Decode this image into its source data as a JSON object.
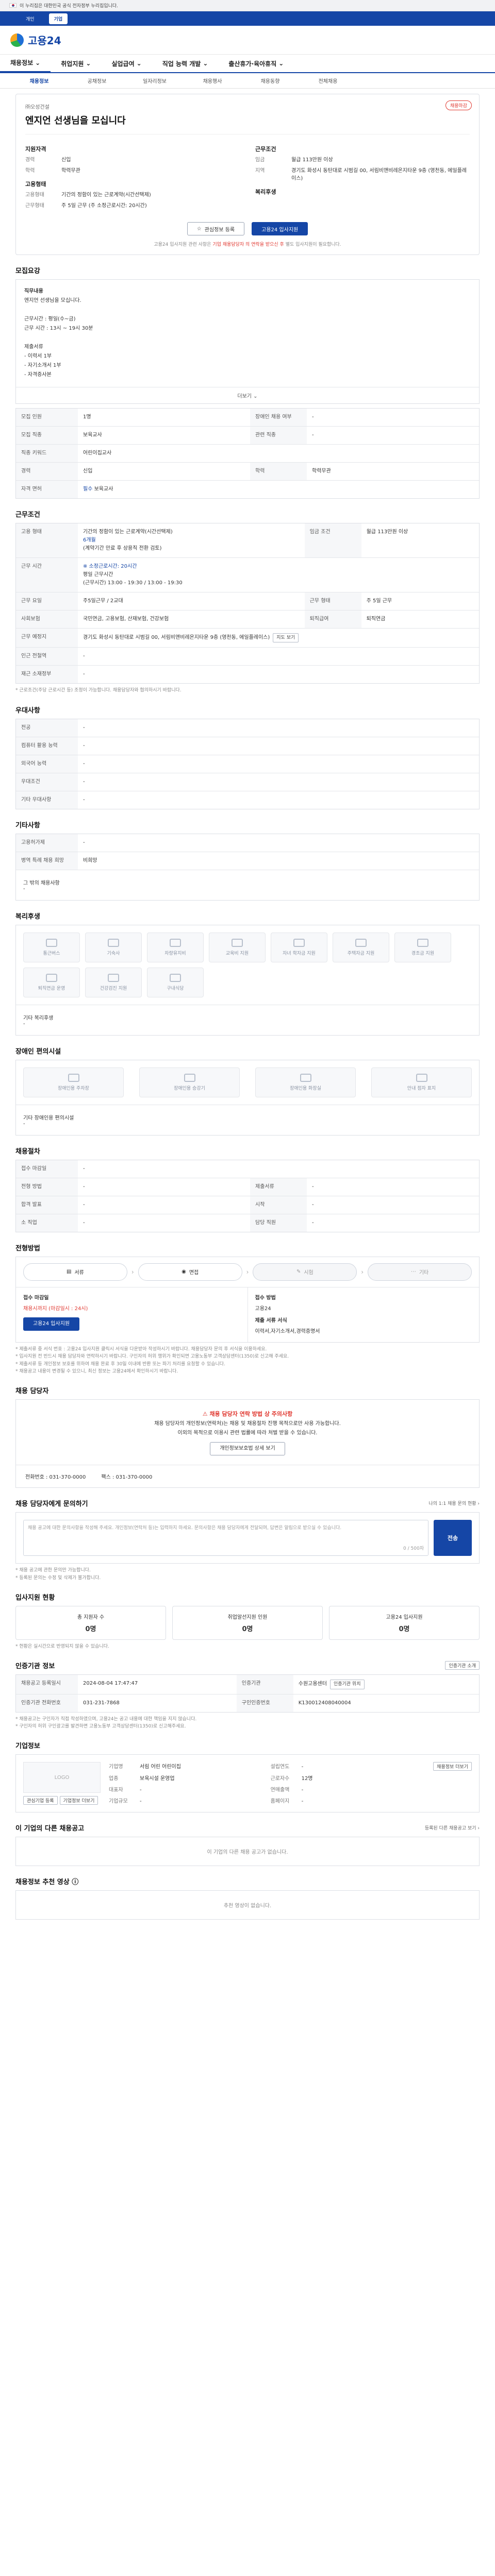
{
  "gov_banner": "이 누리집은 대한민국 공식 전자정부 누리집입니다.",
  "util_tabs": [
    "개인",
    "기업"
  ],
  "brand": {
    "name": "고용24",
    "accent": "#1546a6"
  },
  "gnb": [
    "채용정보",
    "취업지원",
    "실업급여",
    "직업 능력 개발",
    "출산휴가·육아휴직"
  ],
  "subnav": [
    "채용정보",
    "공채정보",
    "일자리정보",
    "채용행사",
    "채용동향",
    "전체채용"
  ],
  "summary": {
    "badge": "채용마감",
    "company": "㈜오성건설",
    "title": "엔지언 선생님을 모십니다",
    "left_head": "지원자격",
    "left": [
      {
        "k": "경력",
        "v": "신입"
      },
      {
        "k": "학력",
        "v": "학력무관"
      }
    ],
    "left_head2": "고용형태",
    "left2": [
      {
        "k": "고용형태",
        "v": "기간의 정함이 있는 근로계약(시간선택제)"
      },
      {
        "k": "근무형태",
        "v": "주 5일 근무 (주 소정근로시간: 20시간)"
      }
    ],
    "right_head": "근무조건",
    "right": [
      {
        "k": "임금",
        "v": "월급 113만원 이상"
      },
      {
        "k": "지역",
        "v": "경기도 화성시 동탄대로 시범길 00, 서림비앤비레온지타운 9층 (영천동, 에일플레이스)"
      }
    ],
    "right_head2": "복리후생",
    "btn_scrap": "관심정보 등록",
    "btn_apply": "고용24 입사지원",
    "note_pre": "고용24 입사지원 관련 사항은 ",
    "note_red": "기업 채용담당자 의 연락을 받으신 후",
    "note_post": " 별도 입사지원이 필요합니다."
  },
  "recruit": {
    "heading": "모집요강",
    "desc_title": "직무내용",
    "desc_lines": [
      "엔지언 선생님을 모십니다.",
      "",
      "근무시간 : 평일(수~금)",
      "근무 시간 : 13시 ~ 19시 30분",
      "",
      "제출서류",
      "- 이력서 1부",
      "- 자기소개서 1부",
      "- 자격증사본"
    ],
    "more": "더보기 ⌄",
    "rows": [
      {
        "k": "모집 인원",
        "v": "1명",
        "k2": "장애인 채용 여부",
        "v2": "-"
      },
      {
        "k": "모집 직종",
        "v": "보육교사",
        "k2": "관련 직종",
        "v2": "-"
      },
      {
        "k": "직종 키워드",
        "v": "어린이집교사",
        "k2": "",
        "v2": ""
      },
      {
        "k": "경력",
        "v": "신입",
        "k2": "학력",
        "v2": "학력무관"
      },
      {
        "k": "자격 면허",
        "v_badge": "필수",
        "v": "보육교사",
        "k2": "",
        "v2": ""
      }
    ]
  },
  "conditions": {
    "heading": "근무조건",
    "emp_type_k": "고용 형태",
    "emp_type_v1": "기간의 정함이 있는 근로계약(시간선택제)",
    "emp_type_v2": "6개월",
    "emp_type_v3": "(계약기간 만료 후 상용직 전환 검토)",
    "wage_k": "임금 조건",
    "wage_v": "월급 113만원 이상",
    "hours_k": "근무 시간",
    "hours_note": "※ 소정근로시간: 20시간",
    "hours_v": "평일 근무시간\n(근무시간) 13:00 - 19:30 / 13:00 - 19:30",
    "rows": [
      {
        "k": "근무 요일",
        "v": "주5일근무 / 2교대",
        "k2": "근무 형태",
        "v2": "주 5일 근무"
      },
      {
        "k": "사회보험",
        "v": "국민연금, 고용보험, 산재보험, 건강보험",
        "k2": "퇴직급여",
        "v2": "퇴직연금"
      },
      {
        "k": "근무 예정지",
        "v": "경기도 화성시 동탄대로 시범길 00, 서림비앤비레온지타운 9층 (영천동, 에일플레이스)",
        "k2": "",
        "v2": ""
      },
      {
        "k": "인근 전철역",
        "v": "-",
        "k2": "",
        "v2": ""
      },
      {
        "k": "재근 소재정부",
        "v": "-",
        "k2": "",
        "v2": ""
      }
    ],
    "map_btn": "지도 보기",
    "footnote": "* 근로조건(주당 근로시간 등) 조정이 가능합니다. 채용담당자와 협의하시기 바랍니다."
  },
  "preference": {
    "heading": "우대사항",
    "rows": [
      {
        "k": "전공",
        "v": "-"
      },
      {
        "k": "컴퓨터 활용 능력",
        "v": "-"
      },
      {
        "k": "외국어 능력",
        "v": "-"
      },
      {
        "k": "우대조건",
        "v": "-"
      },
      {
        "k": "기타 우대사항",
        "v": "-"
      }
    ]
  },
  "etc": {
    "heading": "기타사항",
    "rows": [
      {
        "k": "고용허가제",
        "v": "-"
      },
      {
        "k": "병역 특례 채용 희망",
        "v": "비희망"
      }
    ],
    "other_k": "그 밖의 채용사항",
    "other_v": "-"
  },
  "welfare": {
    "heading": "복리후생",
    "items": [
      "통근버스",
      "기숙사",
      "차량유지비",
      "교육비 지원",
      "자녀 학자금 지원",
      "주택자금 지원",
      "경조금 지원",
      "퇴직연금 운영",
      "건강검진 지원",
      "구내식당"
    ],
    "other_k": "기타 복리후생",
    "other_v": "-"
  },
  "disability": {
    "heading": "장애인 편의시설",
    "items": [
      "장애인용 주차장",
      "장애인용 승강기",
      "장애인용 화장실",
      "안내 점자 표지"
    ],
    "other_k": "기타 장애인용 편의시설",
    "other_v": "-"
  },
  "jobhire": {
    "heading": "채용절차",
    "rows": [
      {
        "k": "접수 마감일",
        "v": "-",
        "k2": "",
        "v2": ""
      },
      {
        "k": "전형 방법",
        "v": "-",
        "k2": "제출서류",
        "v2": "-"
      },
      {
        "k": "합격 발표",
        "v": "-",
        "k2": "시작",
        "v2": "-"
      },
      {
        "k": "소 직업",
        "v": "-",
        "k2": "담당 직원",
        "v2": "-"
      }
    ]
  },
  "process": {
    "heading": "전형방법",
    "steps": [
      "서류",
      "면접",
      "시험",
      "기타"
    ],
    "deadline_lbl": "접수 마감일",
    "deadline_v": "채용시까지 (마감일시 : 24시)",
    "method_lbl": "접수 방법",
    "method_v": "고용24",
    "docs_lbl": "제출 서류 서식",
    "docs_v": "이력서,자기소개서,경력증명서",
    "apply_btn": "고용24 입사지원",
    "notes": [
      "* 제출서류 중 서식 번호 : 고용24 입사지원 클릭시 서식을 다운받아 작성하시기 바랍니다. 채용담당자 문의 후 서식을 이용하세요.",
      "* 입사지원 전 반드시 채용 담당자와 연락하시기 바랍니다. 구인자의 허위 행위가 확인되면 고용노동부 고객상담센터(1350)로 신고해 주세요.",
      "* 제출서류 등 개인정보 보호를 위하여 채용 완료 후 30일 이내에 반환 또는 파기 처리를 요청할 수 있습니다.",
      "* 채용공고 내용이 변경될 수 있으니, 최신 정보는 고용24에서 확인하시기 바랍니다."
    ]
  },
  "manager": {
    "heading": "채용 담당자",
    "alert": "채용 담당자 연락 방법 상 주의사항",
    "line1": "채용 담당자의 개인정보(연락처)는 채용 및 채용절차 진행 목적으로만 사용 가능합니다.",
    "line2": "이외의 목적으로 이용시 관련 법률에 따라 처벌 받을 수 있습니다.",
    "btn": "개인정보보호법 상세 보기",
    "phone": "전화번호 : 031-370-0000",
    "fax": "팩스 : 031-370-0000"
  },
  "inquiry": {
    "heading": "채용 담당자에게 문의하기",
    "right": "나의 1:1 채용 문의 현황 ›",
    "placeholder": "채용 공고에 대한 문의사항을 작성해 주세요. 개인정보(연락처 등)는 입력하지 마세요. 문의사항은 채용 담당자에게 전달되며, 답변은 알림으로 받으실 수 있습니다.",
    "count": "0 / 500자",
    "send": "전송",
    "notes": [
      "* 채용 공고에 관한 문의만 가능합니다.",
      "* 등록된 문의는 수정 및 삭제가 불가합니다."
    ]
  },
  "stats": {
    "heading": "입사지원 현황",
    "items": [
      {
        "k": "총 지원자 수",
        "v": "0명"
      },
      {
        "k": "취업알선지원 인원",
        "v": "0명"
      },
      {
        "k": "고용24 입사지원",
        "v": "0명"
      }
    ],
    "note": "* 현황은 실시간으로 반영되지 않을 수 있습니다."
  },
  "reginfo": {
    "heading": "인증기관 정보",
    "right": "인증기관 소개",
    "rows": [
      {
        "k": "채용공고 등록일시",
        "v": "2024-08-04 17:47:47",
        "k2": "인증기관",
        "v2": "수원고용센터"
      },
      {
        "k": "인증기관 전화번호",
        "v": "031-231-7868",
        "k2": "구인인증번호",
        "v2": "K130012408040004"
      }
    ],
    "btn": "인증기관 위치",
    "notes": [
      "* 채용공고는 구인자가 직접 작성하였으며, 고용24는 공고 내용에 대한 책임을 지지 않습니다.",
      "* 구인자의 허위 구인광고를 발견하면 고용노동부 고객상담센터(1350)로 신고해주세요."
    ]
  },
  "company": {
    "heading": "기업정보",
    "logo": "LOGO",
    "left_btns": [
      "관심기업 등록",
      "기업정보 더보기"
    ],
    "rows": [
      {
        "k": "기업명",
        "v": "서림 어린 어린이집"
      },
      {
        "k": "업종",
        "v": "보육시설 운영업"
      },
      {
        "k": "설립연도",
        "v": "-"
      },
      {
        "k": "근로자수",
        "v": "12명"
      },
      {
        "k": "대표자",
        "v": "-"
      },
      {
        "k": "연매출액",
        "v": "-"
      },
      {
        "k": "기업규모",
        "v": "-"
      },
      {
        "k": "홈페이지",
        "v": "-"
      }
    ],
    "right_btn": "채용정보 더보기"
  },
  "other_jobs": {
    "heading": "이 기업의 다른 채용공고",
    "right": "등록된 다른 채용공고 보기 ›",
    "empty": "이 기업의 다른 채용 공고가 없습니다."
  },
  "recommend": {
    "heading": "채용정보 추천 영상 ⓘ",
    "empty": "추천 영상이 없습니다."
  }
}
